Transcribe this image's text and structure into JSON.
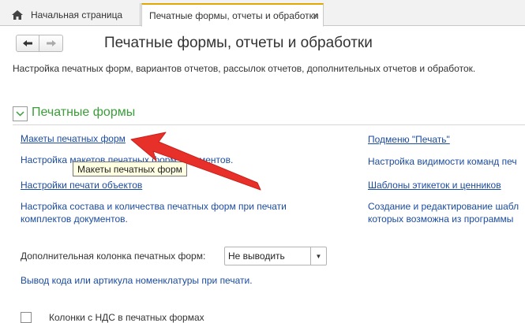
{
  "tabs": {
    "home_label": "Начальная страница",
    "active_label": "Печатные формы, отчеты и обработки",
    "close_glyph": "×"
  },
  "header": {
    "title": "Печатные формы, отчеты и обработки",
    "subtitle": "Настройка печатных форм, вариантов отчетов, рассылок отчетов, дополнительных отчетов и обработок."
  },
  "section": {
    "title": "Печатные формы",
    "accent_color": "#3a9d3a"
  },
  "left_links": {
    "templates": "Макеты печатных форм",
    "doc_settings": "Настройка макетов печатных форм документов.",
    "print_settings": "Настройки печати объектов",
    "compose_settings": "Настройка состава и количества печатных форм при печати комплектов документов."
  },
  "right_links": {
    "replace_print": "Подменю \"Печать\"",
    "visibility": "Настройка видимости команд печ",
    "label_templates": "Шаблоны этикеток и ценников",
    "create_edit": "Создание и редактирование шабл которых возможна из программы"
  },
  "tooltip": "Макеты печатных форм",
  "extra_column": {
    "label": "Дополнительная колонка печатных форм:",
    "value": "Не выводить",
    "hint": "Вывод кода или артикула номенклатуры при печати."
  },
  "vat_checkbox": {
    "label": "Колонки с НДС в печатных формах",
    "checked": false
  },
  "colors": {
    "link": "#1b4b9e",
    "arrow": "#e8302a"
  }
}
